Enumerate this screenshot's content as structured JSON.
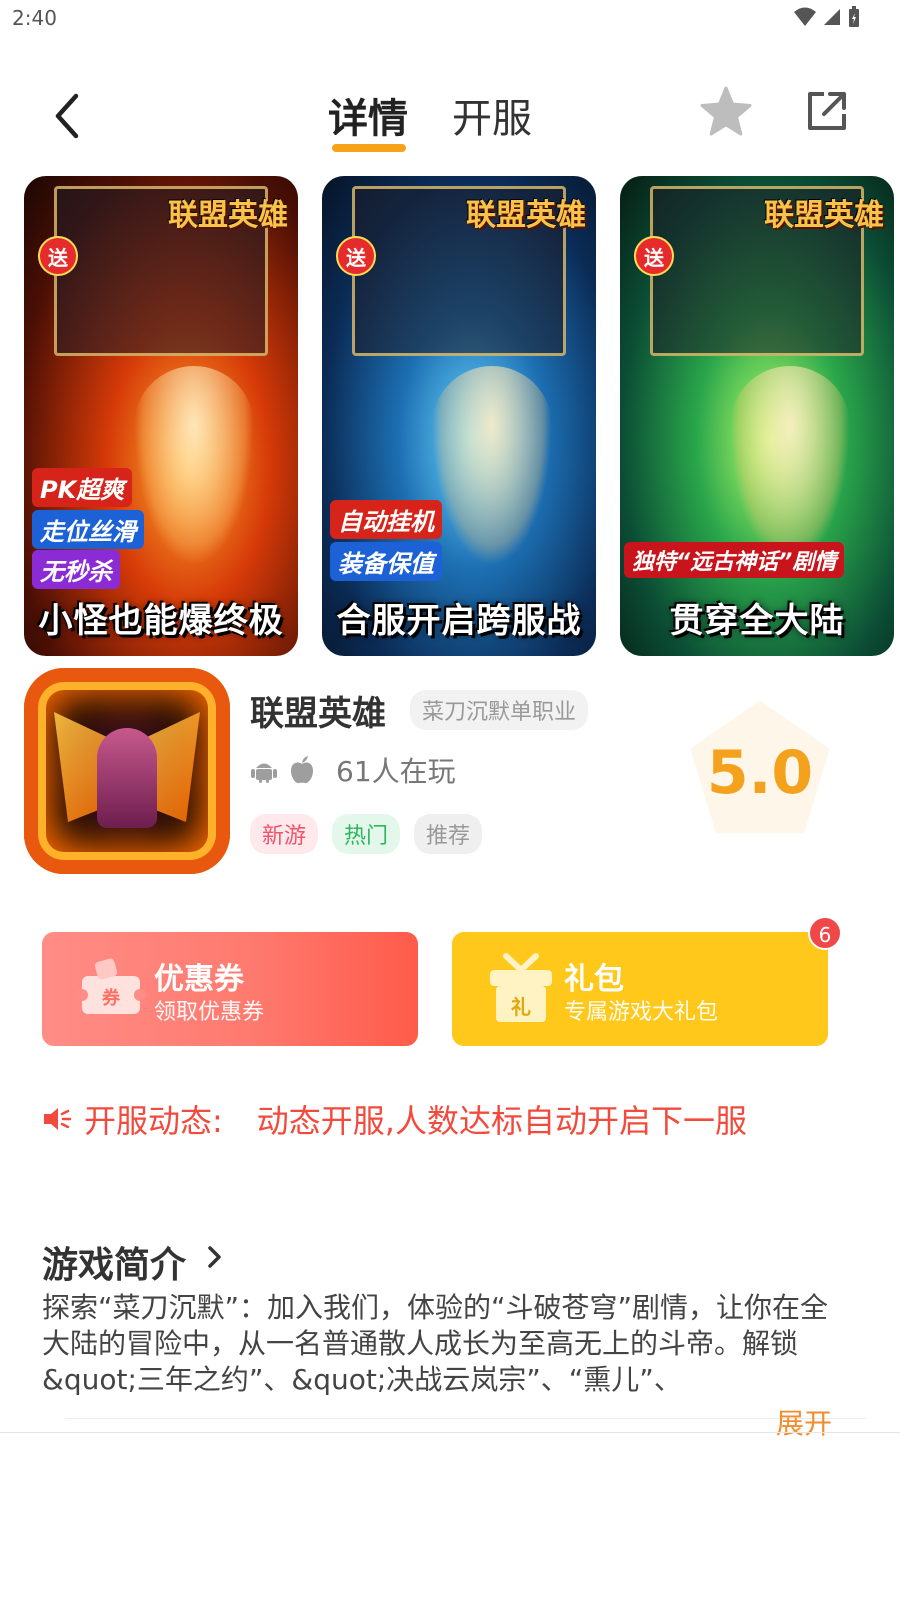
{
  "status_bar": {
    "time": "2:40"
  },
  "nav": {
    "tabs": [
      {
        "label": "详情",
        "active": true
      },
      {
        "label": "开服",
        "active": false
      }
    ],
    "icons": [
      "back-arrow-icon",
      "star-icon",
      "share-icon"
    ]
  },
  "gallery": {
    "screenshots": [
      {
        "logo": "联盟英雄",
        "badge": "送",
        "tags": [
          "PK超爽",
          "走位丝滑",
          "无秒杀"
        ],
        "caption": "小怪也能爆终极"
      },
      {
        "logo": "联盟英雄",
        "badge": "送",
        "tags": [
          "自动挂机",
          "装备保值"
        ],
        "caption": "合服开启跨服战"
      },
      {
        "logo": "联盟英雄",
        "badge": "送",
        "tags": [
          "独特“远古神话”剧情"
        ],
        "caption": "贯穿全大陆"
      }
    ]
  },
  "game": {
    "name": "联盟英雄",
    "subtitle": "菜刀沉默单职业",
    "players": "61人在玩",
    "platforms": [
      "android-icon",
      "apple-icon"
    ],
    "tags": [
      {
        "label": "新游",
        "color": "#f0546a"
      },
      {
        "label": "热门",
        "color": "#2fb55f"
      },
      {
        "label": "推荐",
        "color": "#999999"
      }
    ],
    "rating": "5.0"
  },
  "promos": {
    "coupon": {
      "title": "优惠券",
      "subtitle": "领取优惠券",
      "icon_text": "券"
    },
    "gift": {
      "title": "礼包",
      "subtitle": "专属游戏大礼包",
      "icon_text": "礼",
      "badge": "6"
    }
  },
  "server_notice": {
    "label": "开服动态:",
    "text": "动态开服,人数达标自动开启下一服"
  },
  "intro": {
    "title": "游戏简介",
    "body": "探索“菜刀沉默”：加入我们，体验的“斗破苍穹”剧情，让你在全大陆的冒险中，从一名普通散人成长为至高无上的斗帝。解锁&quot;三年之约”、&quot;决战云岚宗”、“熏儿”、",
    "expand": "展开"
  },
  "colors": {
    "accent": "#f6a31a",
    "notice": "#f24b3d",
    "coupon": "#ff6f63",
    "gift": "#ffc81a",
    "rating": "#f4a21e"
  }
}
